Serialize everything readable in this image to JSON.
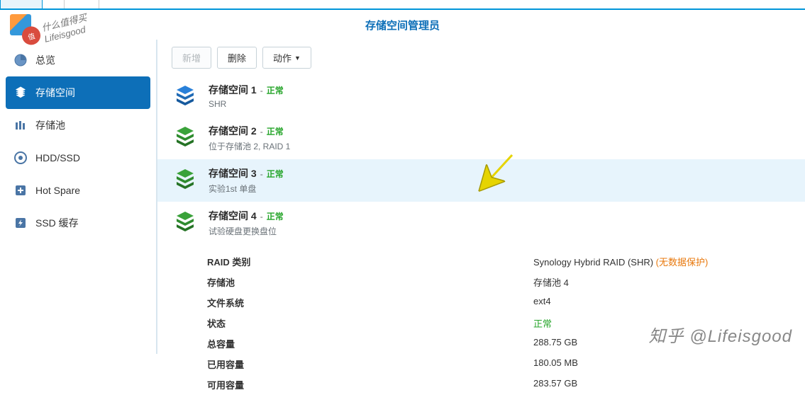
{
  "window": {
    "title": "存储空间管理员"
  },
  "sidebar": {
    "items": [
      {
        "label": "总览"
      },
      {
        "label": "存储空间"
      },
      {
        "label": "存储池"
      },
      {
        "label": "HDD/SSD"
      },
      {
        "label": "Hot Spare"
      },
      {
        "label": "SSD 缓存"
      }
    ]
  },
  "toolbar": {
    "new_label": "新增",
    "delete_label": "删除",
    "action_label": "动作"
  },
  "volumes": [
    {
      "title": "存储空间 1",
      "status": "正常",
      "sub": "SHR"
    },
    {
      "title": "存储空间 2",
      "status": "正常",
      "sub": "位于存储池 2, RAID 1"
    },
    {
      "title": "存储空间 3",
      "status": "正常",
      "sub": "实验1st 单盘"
    },
    {
      "title": "存储空间 4",
      "status": "正常",
      "sub": "试验硬盘更换盘位"
    }
  ],
  "details": {
    "rows": [
      {
        "label": "RAID 类别",
        "value": "Synology Hybrid RAID (SHR)",
        "extra": "(无数据保护)"
      },
      {
        "label": "存储池",
        "value": "存储池 4"
      },
      {
        "label": "文件系统",
        "value": "ext4"
      },
      {
        "label": "状态",
        "value": "正常",
        "green": true
      },
      {
        "label": "总容量",
        "value": "288.75 GB"
      },
      {
        "label": "已用容量",
        "value": "180.05 MB"
      },
      {
        "label": "可用容量",
        "value": "283.57 GB"
      }
    ]
  },
  "watermark": {
    "top1": "什么值得买",
    "top2": "Lifeisgood",
    "bottom": "知乎 @Lifeisgood"
  }
}
